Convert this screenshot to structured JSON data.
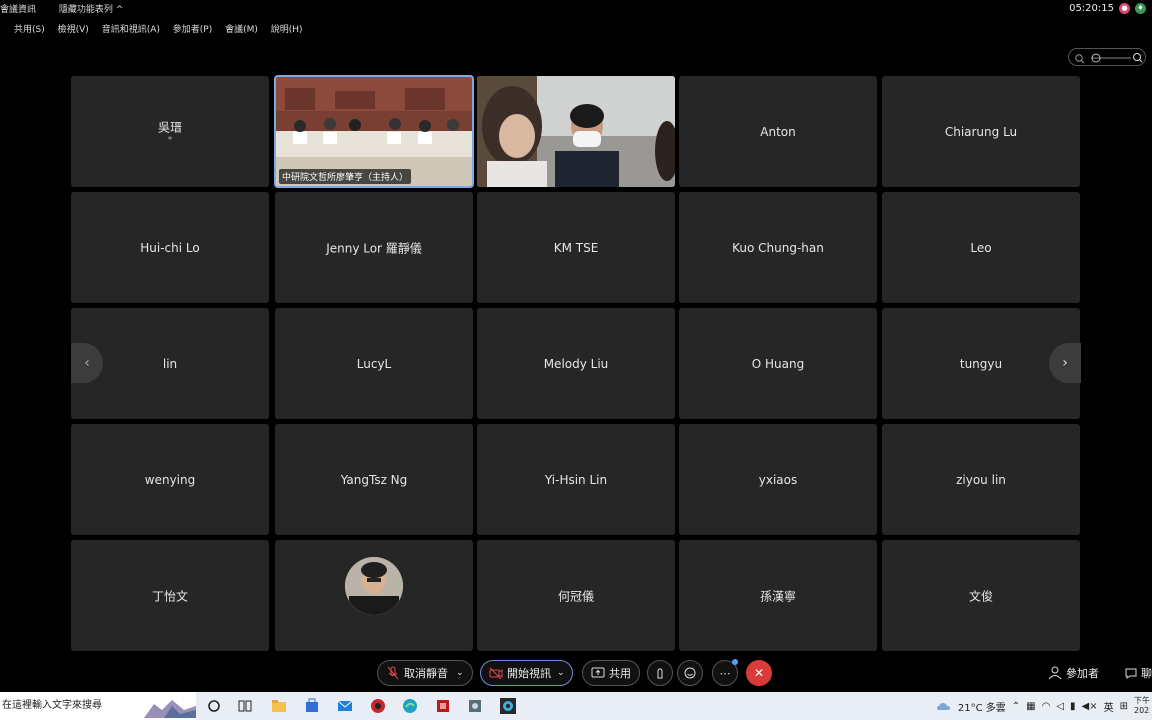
{
  "app": {
    "title": "會議資訊",
    "layout_label": "隱藏功能表列 ^",
    "time": "05:20:15"
  },
  "menu": [
    "共用(S)",
    "檢視(V)",
    "音訊和視訊(A)",
    "參加者(P)",
    "會議(M)",
    "說明(H)"
  ],
  "participants": [
    {
      "name": "吳瑨",
      "sub": "*"
    },
    {
      "name": "",
      "video_label": "中研院文哲所廖肇亨（主持人）",
      "video": "conference"
    },
    {
      "name": "",
      "video": "masked"
    },
    {
      "name": "Anton"
    },
    {
      "name": "Chiarung Lu"
    },
    {
      "name": "Hui-chi Lo"
    },
    {
      "name": "Jenny Lor 羅靜儀"
    },
    {
      "name": "KM TSE"
    },
    {
      "name": "Kuo Chung-han"
    },
    {
      "name": "Leo"
    },
    {
      "name": "lin"
    },
    {
      "name": "LucyL"
    },
    {
      "name": "Melody Liu"
    },
    {
      "name": "O Huang"
    },
    {
      "name": "tungyu"
    },
    {
      "name": "wenying"
    },
    {
      "name": "YangTsz Ng"
    },
    {
      "name": "Yi-Hsin Lin"
    },
    {
      "name": "yxiaos"
    },
    {
      "name": "ziyou lin"
    },
    {
      "name": "丁怡文"
    },
    {
      "name": "",
      "video": "avatar"
    },
    {
      "name": "何冠儀"
    },
    {
      "name": "孫漢寧"
    },
    {
      "name": "文俊"
    }
  ],
  "controls": {
    "unmute": "取消靜音",
    "start_video": "開始視訊",
    "share": "共用",
    "participants": "參加者",
    "chat": "聊"
  },
  "taskbar": {
    "search_placeholder": "在這裡輸入文字來搜尋",
    "weather": "21°C 多雲",
    "ime": "英",
    "clock_top": "下午",
    "clock_bottom": "2022"
  },
  "colors": {
    "tile_bg": "#262626",
    "active_border": "#7aa9e8",
    "leave_red": "#d93a3a"
  }
}
